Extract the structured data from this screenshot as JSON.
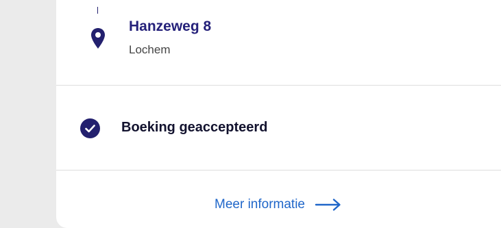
{
  "location": {
    "street": "Hanzeweg 8",
    "city": "Lochem",
    "icon": "map-pin-icon"
  },
  "status": {
    "label": "Boeking geaccepteerd",
    "icon": "check-circle-icon"
  },
  "more_info": {
    "label": "Meer informatie",
    "icon": "arrow-right-icon"
  },
  "colors": {
    "brand_navy": "#25217a",
    "link_blue": "#1f66c9",
    "background": "#ebebeb",
    "card": "#ffffff"
  }
}
